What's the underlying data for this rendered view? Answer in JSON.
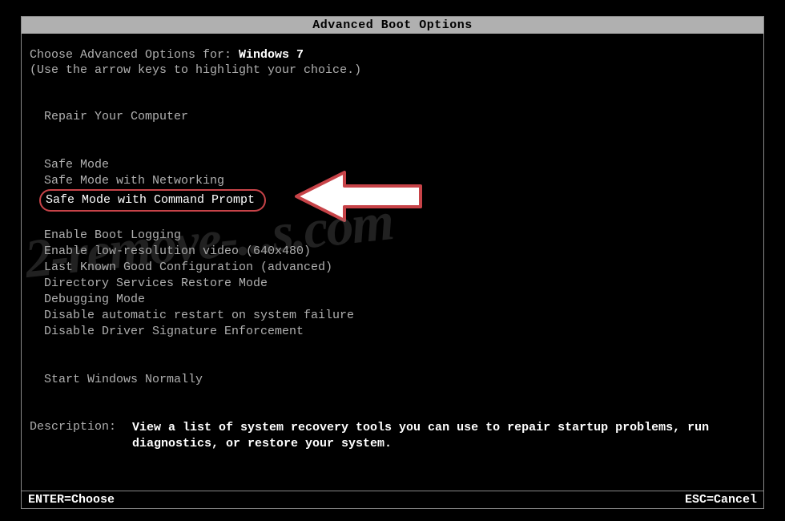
{
  "title": "Advanced Boot Options",
  "intro": {
    "prefix": "Choose Advanced Options for: ",
    "os": "Windows 7",
    "instructions": "(Use the arrow keys to highlight your choice.)"
  },
  "menu": {
    "repair": "Repair Your Computer",
    "items": [
      "Safe Mode",
      "Safe Mode with Networking",
      "Safe Mode with Command Prompt",
      "Enable Boot Logging",
      "Enable low-resolution video (640x480)",
      "Last Known Good Configuration (advanced)",
      "Directory Services Restore Mode",
      "Debugging Mode",
      "Disable automatic restart on system failure",
      "Disable Driver Signature Enforcement"
    ],
    "start_normally": "Start Windows Normally",
    "highlighted_index": 2
  },
  "description": {
    "label": "Description:",
    "text": "View a list of system recovery tools you can use to repair startup problems, run diagnostics, or restore your system."
  },
  "footer": {
    "enter": "ENTER=Choose",
    "esc": "ESC=Cancel"
  },
  "watermark": "2-remove-...s.com"
}
